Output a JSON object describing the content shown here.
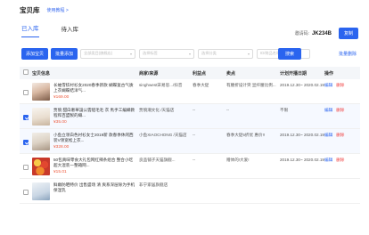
{
  "header": {
    "title": "宝贝库",
    "tutorial_link": "使用教程 >"
  },
  "tabs": [
    {
      "label": "已入库",
      "active": true
    },
    {
      "label": "待入库",
      "active": false
    }
  ],
  "invite": {
    "label": "邀请码:",
    "code": "JK234B",
    "copy_label": "复制"
  },
  "toolbar": {
    "add_label": "添加宝贝",
    "batch_add_label": "批量添加",
    "filter1_placeholder": "全部类目(旗舰店)",
    "filter2_placeholder": "选择标签",
    "filter3_placeholder": "选择分类",
    "search_placeholder": "ID/商品名称",
    "search_label": "搜索",
    "batch_delete_label": "批量删除"
  },
  "table": {
    "headers": [
      "宝贝信息",
      "商家/来源",
      "利益点",
      "卖点",
      "计划开播日期",
      "操作"
    ],
    "rows": [
      {
        "selected": false,
        "name": "长袖雪纺衬衫女2020春季新款 蝴蝶复古气质上衣蝴蝶结洋气...",
        "price": "¥169.00",
        "source": "singhwest宋易思.../抖音",
        "benefit": "春季大促",
        "selling_point": "有腰折设计突 显纤腰比例...",
        "date": "2019.12.30~ 2020.02.19",
        "edit": "编辑",
        "delete": "删除"
      },
      {
        "selected": true,
        "name": "贾貌 甜白奢華設公雲貂毛毛 衣 馬手工編織教程和百盟製的織...",
        "price": "¥35.00",
        "source": "贾貌潮文化 /天猫店",
        "benefit": "--",
        "selling_point": "--",
        "date": "不限",
        "edit": "编辑",
        "delete": "删除"
      },
      {
        "selected": true,
        "name": "小鱼立领白色衬衫女士2019新 款春季休闲西装V领宽松上衣...",
        "price": "¥328.00",
        "source": "小鱼XIAOCHONG /天猫店",
        "benefit": "--",
        "selling_point": "春季大促5折优 惠价!!",
        "date": "2019.12.30~ 2020.02.19",
        "edit": "编辑",
        "delete": "删除"
      },
      {
        "selected": false,
        "name": "50包真味零食大礼包网红辣条组合 整合小吃超大混装一整箱网...",
        "price": "¥15.01",
        "source": "良品铺子天猫旗舰...",
        "benefit": "--",
        "selling_point": "赠体的!大爱!",
        "date": "2019.12.30~ 2020.02.19",
        "edit": "编辑",
        "delete": "删除"
      },
      {
        "selected": false,
        "name": "鲜嫩防晒特价 出售盛场 清 爽系深层除为手机保湿乳",
        "price": "",
        "source": "非宁家居旗舰店",
        "benefit": "",
        "selling_point": "",
        "date": "",
        "edit": "",
        "delete": ""
      }
    ]
  },
  "colors": {
    "accent": "#2a64ef",
    "price": "#ef5a3c",
    "danger": "#ef3c3c"
  }
}
